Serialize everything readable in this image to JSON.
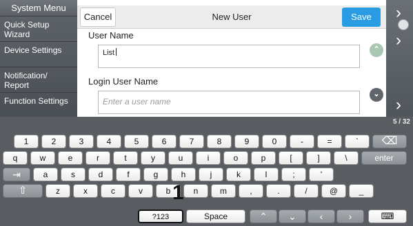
{
  "sidebar": {
    "title": "System Menu",
    "items": [
      {
        "label": "Quick Setup Wizard"
      },
      {
        "label": "Device Settings"
      },
      {
        "label": "Notification/ Report"
      },
      {
        "label": "Function Settings"
      }
    ]
  },
  "dialog": {
    "cancel_label": "Cancel",
    "title": "New User",
    "save_label": "Save",
    "user_name": {
      "label": "User Name",
      "value": "List"
    },
    "login_user_name": {
      "label": "Login User Name",
      "placeholder": "Enter a user name"
    }
  },
  "right_strip": {
    "page_indicator": "5 / 32"
  },
  "keyboard": {
    "row1": [
      "1",
      "2",
      "3",
      "4",
      "5",
      "6",
      "7",
      "8",
      "9",
      "0",
      "-",
      "=",
      "`"
    ],
    "row2": [
      "q",
      "w",
      "e",
      "r",
      "t",
      "y",
      "u",
      "i",
      "o",
      "p",
      "[",
      "]",
      "\\"
    ],
    "row3": [
      "a",
      "s",
      "d",
      "f",
      "g",
      "h",
      "j",
      "k",
      "l",
      ";",
      "'"
    ],
    "row4": [
      "z",
      "x",
      "c",
      "v",
      "b",
      "n",
      "m",
      ",",
      ".",
      "/",
      "@",
      "_"
    ],
    "enter_label": "enter",
    "symbols_label": "?123",
    "space_label": "Space",
    "callout": "1"
  },
  "colors": {
    "accent": "#2a9ce4",
    "sidebar_bg": "#55595e",
    "keyboard_bg": "#595d62"
  }
}
